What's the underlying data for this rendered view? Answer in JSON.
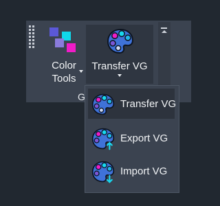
{
  "ribbon": {
    "color_tools": {
      "line1": "Color",
      "line2": "Tools"
    },
    "transfer_vg": {
      "label": "Transfer VG"
    },
    "group_label": "G"
  },
  "menu": {
    "items": [
      {
        "label": "Transfer VG",
        "icon": "palette-icon",
        "selected": true
      },
      {
        "label": "Export VG",
        "icon": "palette-export-icon",
        "selected": false
      },
      {
        "label": "Import VG",
        "icon": "palette-import-icon",
        "selected": false
      }
    ]
  },
  "colors": {
    "background": "#212830",
    "panel": "#3b4350",
    "accent_cyan": "#18d9f0",
    "palette_blue": "#3f72d8"
  }
}
